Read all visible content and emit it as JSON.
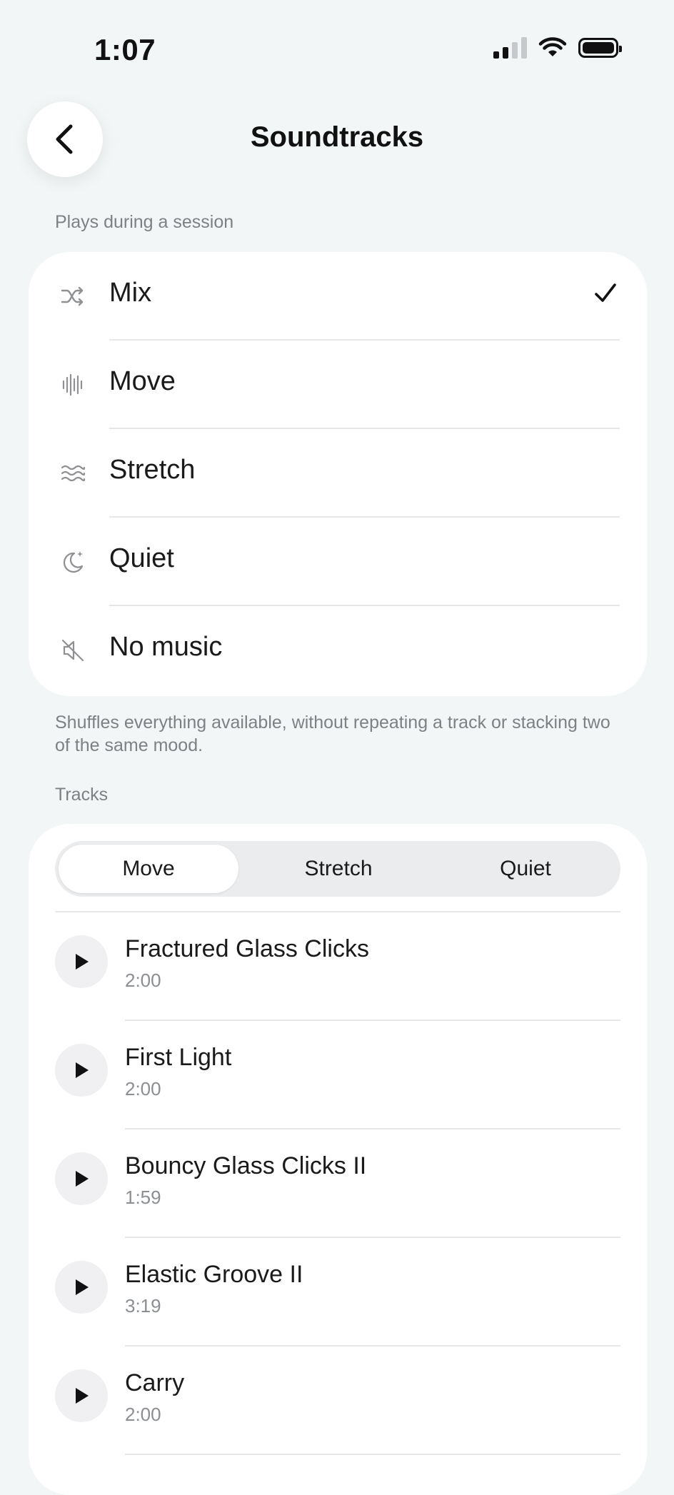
{
  "status_bar": {
    "time": "1:07"
  },
  "header": {
    "title": "Soundtracks"
  },
  "session_section": {
    "label": "Plays during a session",
    "selected": "Mix",
    "options": [
      {
        "label": "Mix",
        "icon": "shuffle-icon",
        "selected": true
      },
      {
        "label": "Move",
        "icon": "waveform-icon",
        "selected": false
      },
      {
        "label": "Stretch",
        "icon": "waves-icon",
        "selected": false
      },
      {
        "label": "Quiet",
        "icon": "moon-stars-icon",
        "selected": false
      },
      {
        "label": "No music",
        "icon": "speaker-muted-icon",
        "selected": false
      }
    ],
    "footnote": "Shuffles everything available, without repeating a track or stacking two of the same mood."
  },
  "tracks_section": {
    "label": "Tracks",
    "tabs": [
      {
        "label": "Move",
        "active": true
      },
      {
        "label": "Stretch",
        "active": false
      },
      {
        "label": "Quiet",
        "active": false
      }
    ],
    "tracks": [
      {
        "title": "Fractured Glass Clicks",
        "duration": "2:00"
      },
      {
        "title": "First Light",
        "duration": "2:00"
      },
      {
        "title": "Bouncy Glass Clicks II",
        "duration": "1:59"
      },
      {
        "title": "Elastic Groove II",
        "duration": "3:19"
      },
      {
        "title": "Carry",
        "duration": "2:00"
      }
    ]
  },
  "colors": {
    "background": "#f3f6f6",
    "card": "#ffffff",
    "muted_text": "#7d8084",
    "icon_gray": "#8e9094"
  }
}
